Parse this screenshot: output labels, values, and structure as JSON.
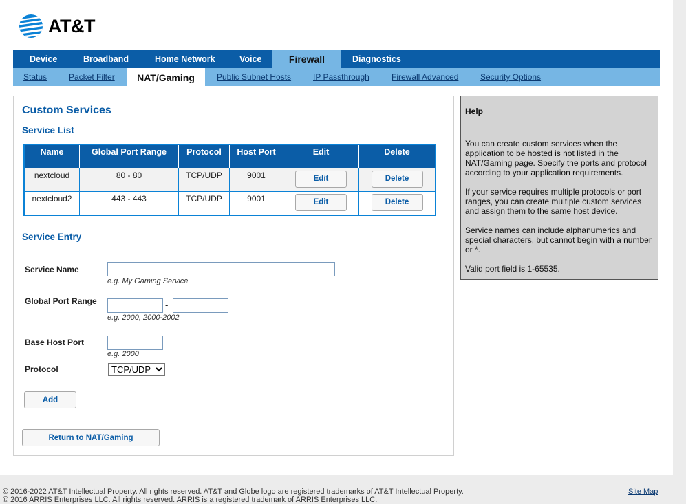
{
  "brand": {
    "logo_text": "AT&T",
    "globe_color": "#0b82d6"
  },
  "nav": {
    "main": [
      "Device",
      "Broadband",
      "Home Network",
      "Voice",
      "Firewall",
      "Diagnostics"
    ],
    "main_active": "Firewall",
    "sub": [
      "Status",
      "Packet Filter",
      "NAT/Gaming",
      "Public Subnet Hosts",
      "IP Passthrough",
      "Firewall Advanced",
      "Security Options"
    ],
    "sub_active": "NAT/Gaming"
  },
  "content": {
    "title": "Custom Services",
    "service_list": {
      "heading": "Service List",
      "columns": [
        "Name",
        "Global Port Range",
        "Protocol",
        "Host Port",
        "Edit",
        "Delete"
      ],
      "rows": [
        {
          "name": "nextcloud",
          "range": "80 - 80",
          "protocol": "TCP/UDP",
          "host_port": "9001",
          "edit": "Edit",
          "delete": "Delete"
        },
        {
          "name": "nextcloud2",
          "range": "443 - 443",
          "protocol": "TCP/UDP",
          "host_port": "9001",
          "edit": "Edit",
          "delete": "Delete"
        }
      ]
    },
    "entry": {
      "heading": "Service Entry",
      "service_name_label": "Service Name",
      "service_name_value": "",
      "service_name_hint": "e.g. My Gaming Service",
      "port_range_label": "Global Port Range",
      "port_range_start": "",
      "port_range_end": "",
      "port_range_dash": "-",
      "port_range_hint": "e.g. 2000, 2000-2002",
      "host_port_label": "Base Host Port",
      "host_port_value": "",
      "host_port_hint": "e.g. 2000",
      "protocol_label": "Protocol",
      "protocol_selected": "TCP/UDP",
      "add_label": "Add",
      "return_label": "Return to NAT/Gaming"
    }
  },
  "help": {
    "title": "Help",
    "paragraphs": [
      "You can create custom services when the application to be hosted is not listed in the NAT/Gaming page. Specify the ports and protocol according to your application requirements.",
      "If your service requires multiple protocols or port ranges, you can create multiple custom services and assign them to the same host device.",
      "Service names can include alphanumerics and special characters, but cannot begin with a number or *.",
      "Valid port field is 1-65535."
    ]
  },
  "footer": {
    "line1": "© 2016-2022 AT&T Intellectual Property. All rights reserved. AT&T and Globe logo are registered trademarks of AT&T Intellectual Property.",
    "line2": "© 2016 ARRIS Enterprises LLC. All rights reserved. ARRIS is a registered trademark of ARRIS Enterprises LLC.",
    "sitemap": "Site Map"
  }
}
